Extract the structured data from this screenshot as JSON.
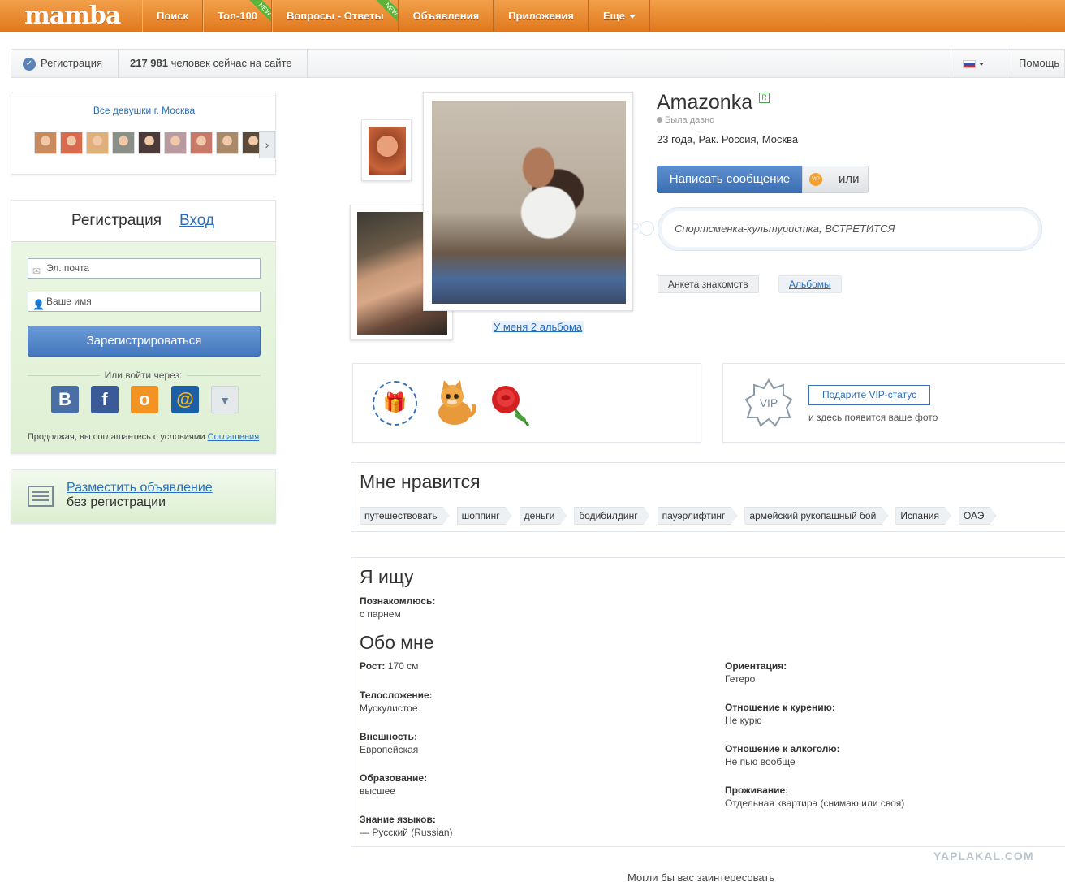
{
  "header": {
    "logo": "mamba",
    "nav": [
      {
        "label": "Поиск",
        "badge": ""
      },
      {
        "label": "Топ-100",
        "badge": "NEW"
      },
      {
        "label": "Вопросы - Ответы",
        "badge": "NEW"
      },
      {
        "label": "Объявления",
        "badge": ""
      },
      {
        "label": "Приложения",
        "badge": ""
      },
      {
        "label": "Еще",
        "badge": ""
      }
    ],
    "accent_color": "#e98a2f"
  },
  "subbar": {
    "register": "Регистрация",
    "online_count": "217 981",
    "online_text": "человек сейчас на сайте",
    "help": "Помощь"
  },
  "sidebar": {
    "girls_link": "Все девушки г. Москва",
    "thumb_colors": [
      "#c98a5e",
      "#d96a4e",
      "#e0b07a",
      "#8a8f88",
      "#4a3a3a",
      "#b89aa0",
      "#c87a6a",
      "#a88a6a",
      "#5a4a3a"
    ],
    "reg": {
      "tab_register": "Регистрация",
      "tab_login": "Вход",
      "email_placeholder": "Эл. почта",
      "name_placeholder": "Ваше имя",
      "submit": "Зарегистрироваться",
      "or_via": "Или войти через:",
      "agree_text": "Продолжая, вы соглашаетесь с условиями",
      "agree_link": "Соглашения"
    },
    "ad": {
      "link": "Разместить объявление",
      "sub": "без регистрации"
    }
  },
  "profile": {
    "name": "Amazonka",
    "real_badge": "R",
    "status": "Была давно",
    "info": "23 года, Рак. Россия, Москва",
    "message_button": "Написать сообщение",
    "vip_coin": "VIP",
    "or_label": "или",
    "quote": "Спортсменка-культуристка, ВСТРЕТИТСЯ",
    "albums_link": "У меня 2 альбома",
    "tab_anketa": "Анкета знакомств",
    "tab_albums": "Альбомы"
  },
  "gifts": {
    "plus": "🎁"
  },
  "vip": {
    "badge": "VIP",
    "button": "Подарите VIP-статус",
    "note": "и здесь появится ваше фото"
  },
  "likes": {
    "title": "Мне нравится",
    "tags": [
      "путешествовать",
      "шоппинг",
      "деньги",
      "бодибилдинг",
      "пауэрлифтинг",
      "армейский рукопашный бой",
      "Испания",
      "ОАЭ"
    ]
  },
  "seeking": {
    "title": "Я ищу",
    "label": "Познакомлюсь:",
    "value": "с парнем"
  },
  "about": {
    "title": "Обо мне",
    "height_label": "Рост:",
    "height_value": "170 см",
    "left": [
      {
        "label": "Телосложение:",
        "value": "Мускулистое"
      },
      {
        "label": "Внешность:",
        "value": "Европейская"
      },
      {
        "label": "Образование:",
        "value": "высшее"
      },
      {
        "label": "Знание языков:",
        "value": "— Русский (Russian)"
      }
    ],
    "right": [
      {
        "label": "Ориентация:",
        "value": "Гетеро"
      },
      {
        "label": "Отношение к курению:",
        "value": "Не курю"
      },
      {
        "label": "Отношение к алкоголю:",
        "value": "Не пью вообще"
      },
      {
        "label": "Проживание:",
        "value": "Отдельная квартира (снимаю или своя)"
      }
    ]
  },
  "footer": {
    "watermark": "YAPLAKAL.COM",
    "bottom_text": "Могли бы вас заинтересовать"
  }
}
